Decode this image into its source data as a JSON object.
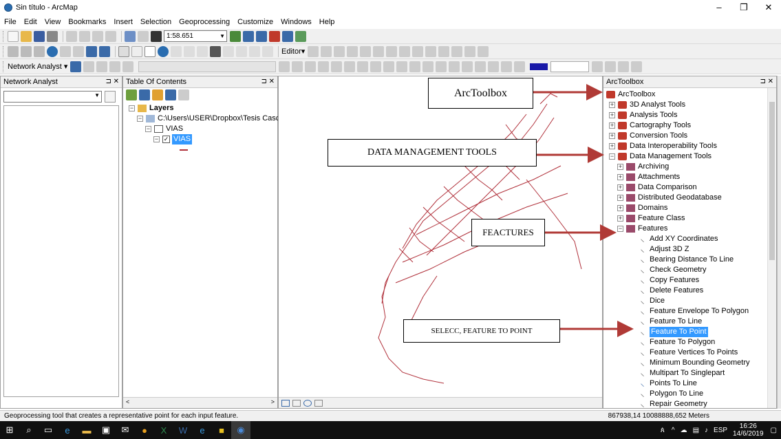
{
  "window": {
    "title": "Sin título - ArcMap",
    "controls": [
      "–",
      "❐",
      "✕"
    ]
  },
  "menu": [
    "File",
    "Edit",
    "View",
    "Bookmarks",
    "Insert",
    "Selection",
    "Geoprocessing",
    "Customize",
    "Windows",
    "Help"
  ],
  "toolbar": {
    "scale": "1:58.651",
    "editor_label": "Editor▾",
    "network_analyst_label": "Network Analyst ▾"
  },
  "network_panel": {
    "title": "Network Analyst"
  },
  "toc": {
    "title": "Table Of Contents",
    "layers_label": "Layers",
    "path_label": "C:\\Users\\USER\\Dropbox\\Tesis Casco y",
    "group_label": "VIAS",
    "layer_label": "VIAS"
  },
  "arctoolbox": {
    "title": "ArcToolbox",
    "root": "ArcToolbox",
    "toolsets": [
      "3D Analyst Tools",
      "Analysis Tools",
      "Cartography Tools",
      "Conversion Tools",
      "Data Interoperability Tools",
      "Data Management Tools"
    ],
    "dm_children": [
      "Archiving",
      "Attachments",
      "Data Comparison",
      "Distributed Geodatabase",
      "Domains",
      "Feature Class",
      "Features"
    ],
    "feature_tools": [
      "Add XY Coordinates",
      "Adjust 3D Z",
      "Bearing Distance To Line",
      "Check Geometry",
      "Copy Features",
      "Delete Features",
      "Dice",
      "Feature Envelope To Polygon",
      "Feature To Line",
      "Feature To Point",
      "Feature To Polygon",
      "Feature Vertices To Points",
      "Minimum Bounding Geometry",
      "Multipart To Singlepart",
      "Points To Line",
      "Polygon To Line",
      "Repair Geometry"
    ],
    "selected_tool": "Feature To Point"
  },
  "annotations": {
    "arctoolbox": "ArcToolbox",
    "data_management": "DATA MANAGEMENT TOOLS",
    "features": "FEACTURES",
    "feature_to_point": "SELECC, FEATURE TO POINT"
  },
  "status": {
    "message": "Geoprocessing tool that creates a representative point for each input feature.",
    "coordinates": "867938,14  10088888,652 Meters"
  },
  "taskbar": {
    "lang": "ESP",
    "time": "16:26",
    "date": "14/6/2019"
  },
  "colors": {
    "selection": "#3399ff",
    "arrow": "#b03a36",
    "toolbox_red": "#c0392b",
    "road_red": "#b0303a"
  }
}
